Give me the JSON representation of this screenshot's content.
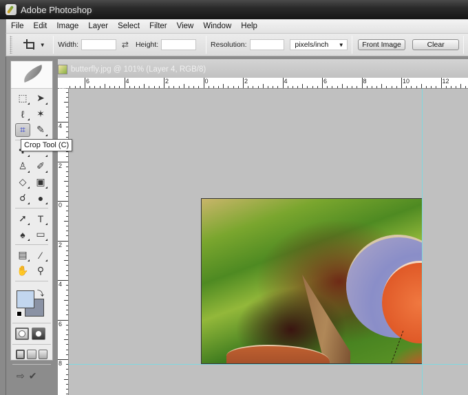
{
  "window": {
    "title": "Adobe Photoshop",
    "app_icon": "photoshop-app-icon"
  },
  "menu": {
    "items": [
      "File",
      "Edit",
      "Image",
      "Layer",
      "Select",
      "Filter",
      "View",
      "Window",
      "Help"
    ]
  },
  "options_bar": {
    "tool_icon": "crop-icon",
    "width_label": "Width:",
    "width_value": "",
    "swap_icon": "swap-arrows-icon",
    "height_label": "Height:",
    "height_value": "",
    "resolution_label": "Resolution:",
    "resolution_value": "",
    "units_selected": "pixels/inch",
    "front_image_label": "Front Image",
    "clear_label": "Clear"
  },
  "tools": {
    "active_tool": "Crop Tool",
    "tooltip": "Crop Tool (C)",
    "rows": [
      [
        "rectangular-marquee",
        "move"
      ],
      [
        "lasso",
        "magic-wand"
      ],
      [
        "crop",
        "slice"
      ],
      [
        "healing-brush",
        "brush"
      ],
      [
        "clone-stamp",
        "history-brush"
      ],
      [
        "eraser",
        "gradient"
      ],
      [
        "blur",
        "dodge"
      ],
      [
        "path-selection",
        "type"
      ],
      [
        "pen",
        "shape"
      ],
      [
        "notes",
        "eyedropper"
      ],
      [
        "hand",
        "zoom"
      ]
    ],
    "foreground_color": "#c2d6ee",
    "background_color": "#8a92a4"
  },
  "document": {
    "tab_title": "butterfly.jpg @ 101% (Layer 4, RGB/8)",
    "ruler_h_labels": [
      "6",
      "4",
      "2",
      "0",
      "2",
      "4",
      "6",
      "8",
      "10",
      "12"
    ],
    "ruler_v_labels": [
      "4",
      "2",
      "0",
      "2",
      "4",
      "6",
      "8"
    ],
    "guide_color": "#7fd8e0"
  }
}
